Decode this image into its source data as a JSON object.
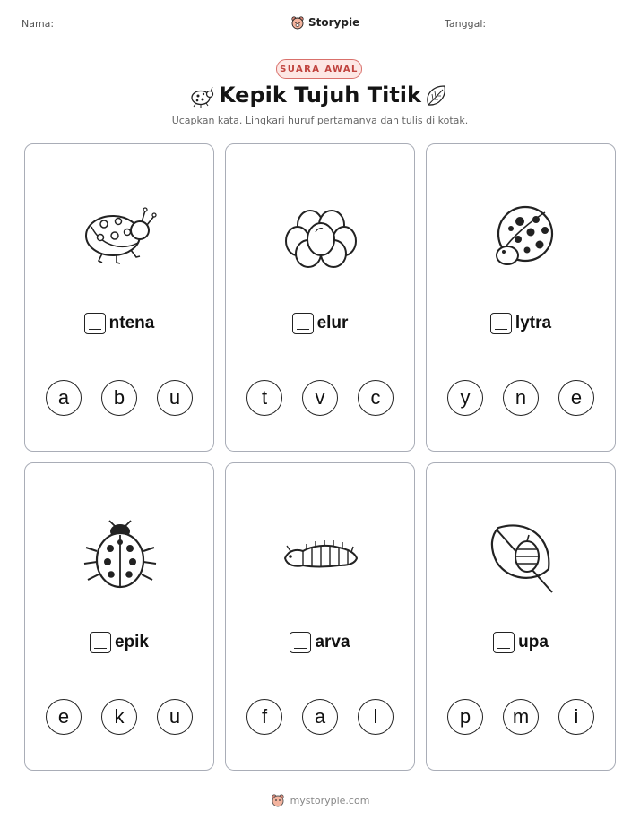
{
  "header": {
    "name_label": "Nama:",
    "date_label": "Tanggal:",
    "brand": "Storypie"
  },
  "badge": "SUARA AWAL",
  "title": "Kepik Tujuh Titik",
  "subtitle": "Ucapkan kata. Lingkari huruf pertamanya dan tulis di kotak.",
  "cards": [
    {
      "picture": "ladybug-side-icon",
      "word_rest": "ntena",
      "options": [
        "a",
        "b",
        "u"
      ]
    },
    {
      "picture": "eggs-icon",
      "word_rest": "elur",
      "options": [
        "t",
        "v",
        "c"
      ]
    },
    {
      "picture": "ladybug-top-icon",
      "word_rest": "lytra",
      "options": [
        "y",
        "n",
        "e"
      ]
    },
    {
      "picture": "ladybug-front-icon",
      "word_rest": "epik",
      "options": [
        "e",
        "k",
        "u"
      ]
    },
    {
      "picture": "larva-icon",
      "word_rest": "arva",
      "options": [
        "f",
        "a",
        "l"
      ]
    },
    {
      "picture": "pupa-on-leaf-icon",
      "word_rest": "upa",
      "options": [
        "p",
        "m",
        "i"
      ]
    }
  ],
  "footer": {
    "site": "mystorypie.com"
  },
  "colors": {
    "badge_border": "#d9706b",
    "badge_fill": "#fde7e4",
    "badge_text": "#c0433e",
    "card_border": "#a9adb7"
  }
}
